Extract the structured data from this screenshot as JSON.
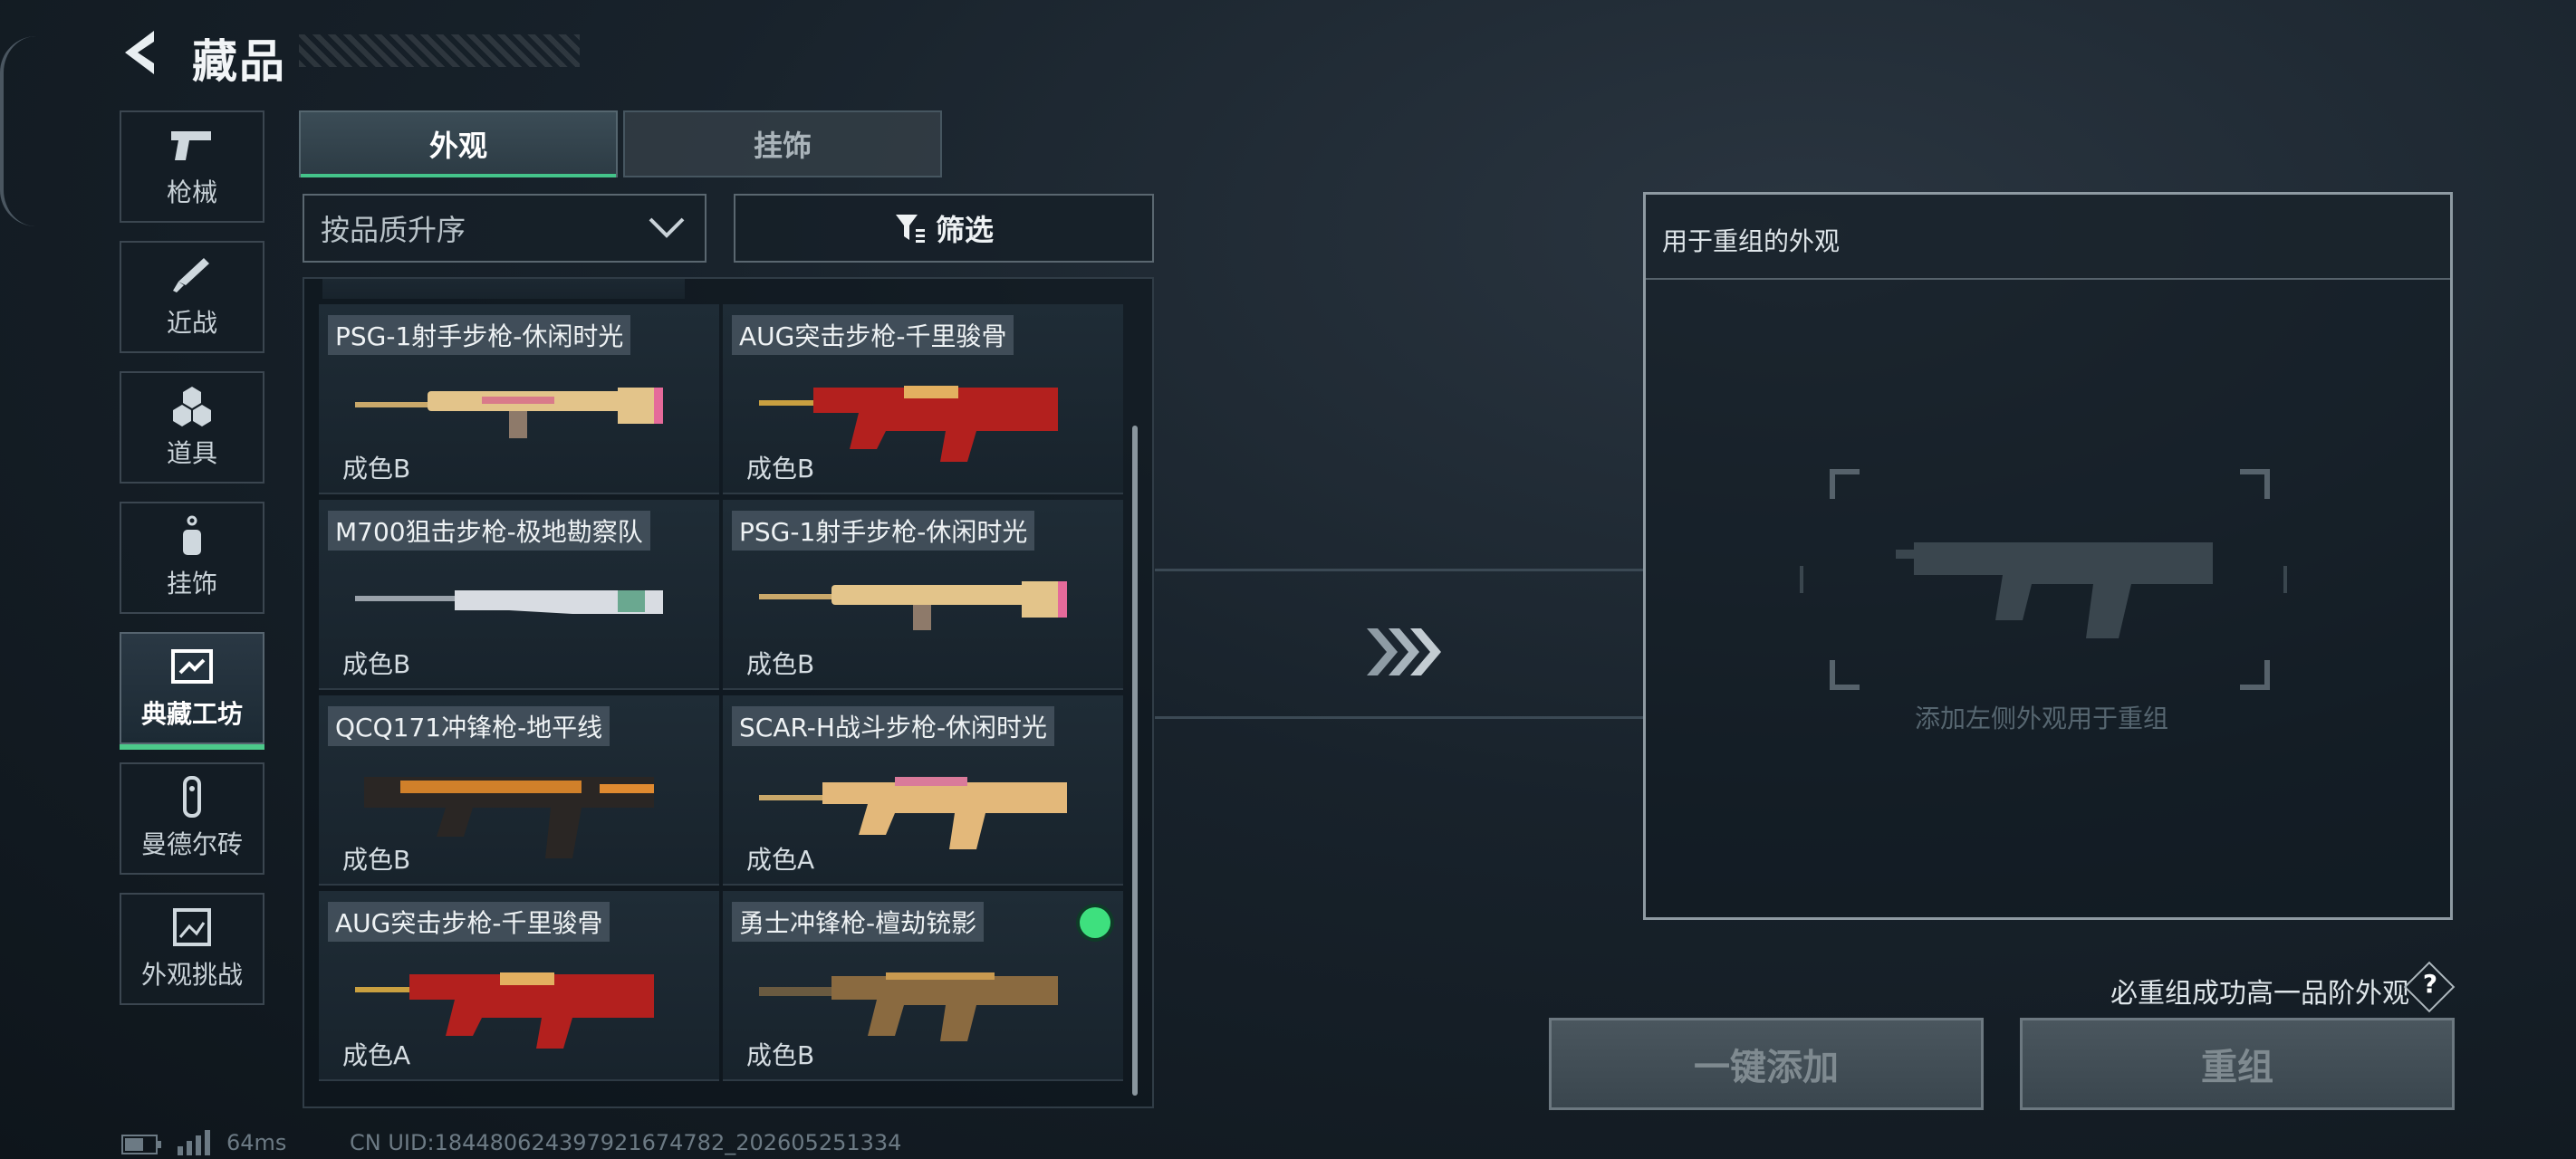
{
  "header": {
    "title": "藏品"
  },
  "sidebar": {
    "items": [
      {
        "label": "枪械",
        "icon": "pistol-icon"
      },
      {
        "label": "近战",
        "icon": "knife-icon"
      },
      {
        "label": "道具",
        "icon": "grenade-icon"
      },
      {
        "label": "挂饰",
        "icon": "charm-icon"
      },
      {
        "label": "典藏工坊",
        "icon": "workshop-icon",
        "active": true
      },
      {
        "label": "曼德尔砖",
        "icon": "brick-icon"
      },
      {
        "label": "外观挑战",
        "icon": "challenge-icon"
      }
    ]
  },
  "tabs": [
    {
      "label": "外观",
      "active": true
    },
    {
      "label": "挂饰",
      "active": false
    }
  ],
  "sort": {
    "label": "按品质升序"
  },
  "filter": {
    "label": "筛选"
  },
  "items": [
    {
      "name": "PSG-1射手步枪-休闲时光",
      "grade": "成色B"
    },
    {
      "name": "AUG突击步枪-千里骏骨",
      "grade": "成色B"
    },
    {
      "name": "M700狙击步枪-极地勘察队",
      "grade": "成色B"
    },
    {
      "name": "PSG-1射手步枪-休闲时光",
      "grade": "成色B"
    },
    {
      "name": "QCQ171冲锋枪-地平线",
      "grade": "成色B"
    },
    {
      "name": "SCAR-H战斗步枪-休闲时光",
      "grade": "成色A"
    },
    {
      "name": "AUG突击步枪-千里骏骨",
      "grade": "成色A"
    },
    {
      "name": "勇士冲锋枪-檀劫铳影",
      "grade": "成色B",
      "selected": true
    }
  ],
  "panel": {
    "title": "用于重组的外观",
    "hint": "添加左侧外观用于重组"
  },
  "note": "必重组成功高一品阶外观",
  "buttons": {
    "add_all": "一键添加",
    "recombine": "重组"
  },
  "status": {
    "ping": "64ms",
    "uid": "CN UID:184480624397921674782_202605251334"
  },
  "colors": {
    "accent": "#44c48a",
    "selected": "#3ee07e"
  }
}
